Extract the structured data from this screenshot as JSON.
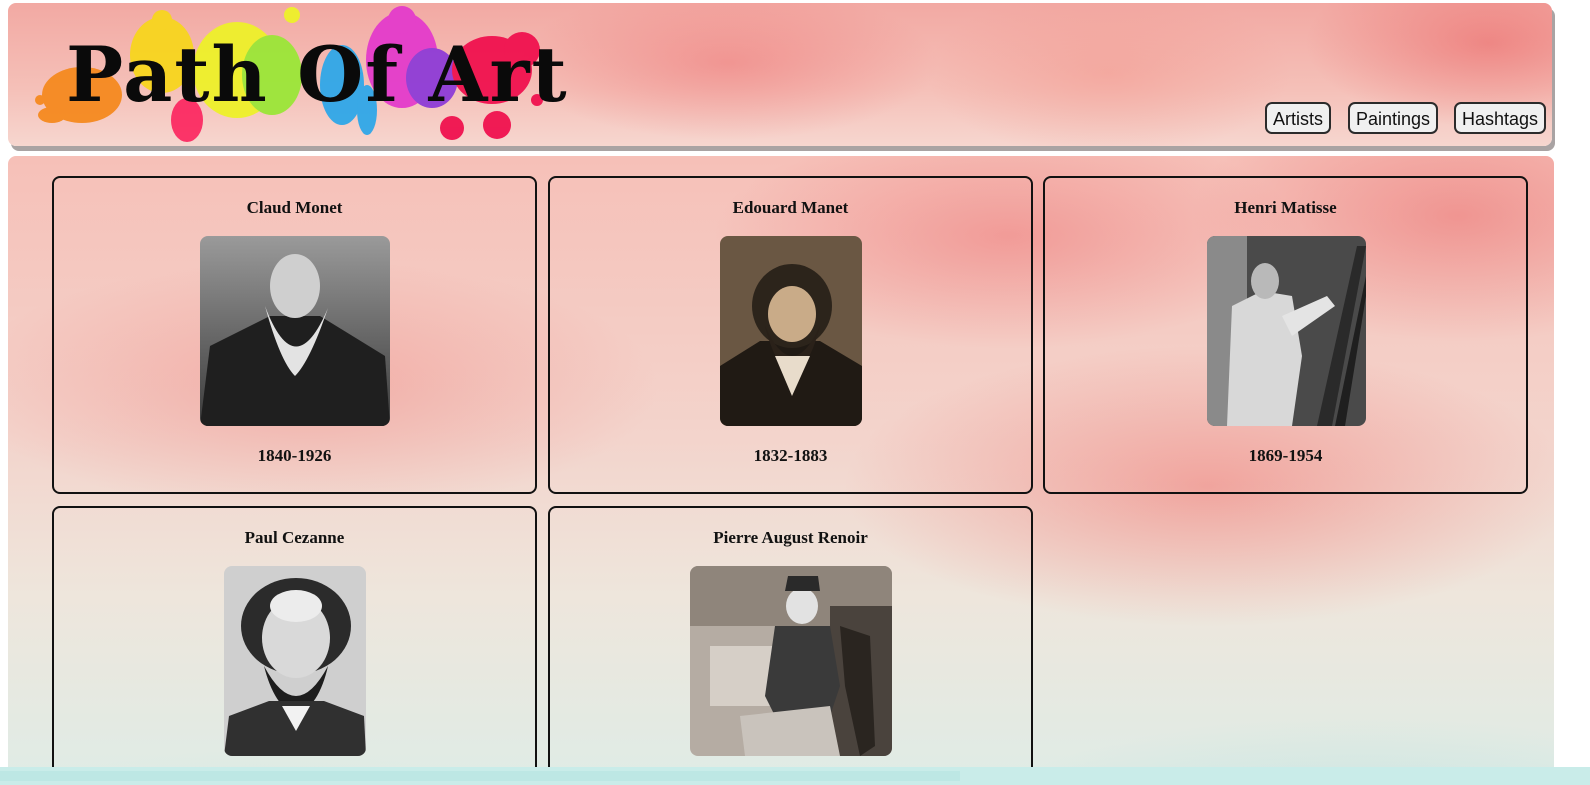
{
  "header": {
    "logo_text": "Path Of Art",
    "nav": [
      {
        "label": "Artists"
      },
      {
        "label": "Paintings"
      },
      {
        "label": "Hashtags"
      }
    ]
  },
  "artists": [
    {
      "name": "Claud Monet",
      "years": "1840-1926"
    },
    {
      "name": "Edouard Manet",
      "years": "1832-1883"
    },
    {
      "name": "Henri Matisse",
      "years": "1869-1954"
    },
    {
      "name": "Paul Cezanne",
      "years": ""
    },
    {
      "name": "Pierre August Renoir",
      "years": ""
    }
  ],
  "colors": {
    "card_border": "#111111",
    "nav_button_bg": "#f0f0f0",
    "header_shadow": "#a9a3a3"
  }
}
